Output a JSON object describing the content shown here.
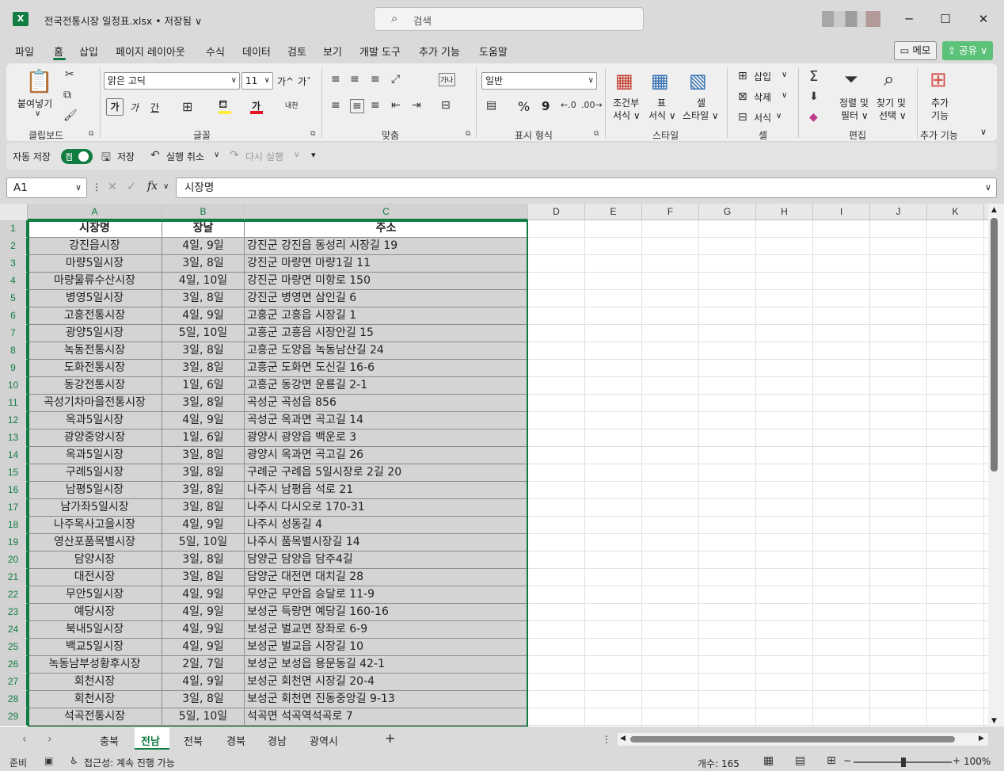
{
  "titlebar": {
    "app_icon": "X",
    "doc_title": "전국전통시장 일정표.xlsx • 저장됨 ∨",
    "search_placeholder": "검색",
    "minimize": "─",
    "maximize": "☐",
    "close": "✕"
  },
  "menu": {
    "items": [
      "파일",
      "홈",
      "삽입",
      "페이지 레이아웃",
      "수식",
      "데이터",
      "검토",
      "보기",
      "개발 도구",
      "추가 기능",
      "도움말"
    ],
    "active": "홈",
    "memo": "▭ 메모",
    "share": "⇪ 공유 ∨"
  },
  "ribbon": {
    "clipboard": {
      "paste": "붙여넣기",
      "label": "클립보드"
    },
    "font": {
      "name": "맑은 고딕",
      "size": "11",
      "grow": "가^",
      "shrink": "가ˇ",
      "bold": "가",
      "italic": "가",
      "underline": "간",
      "fontcolor": "가",
      "phonetic": "내천",
      "label": "글꼴"
    },
    "alignment": {
      "label": "맞춤",
      "wrap": "가나"
    },
    "number": {
      "format": "일반",
      "label": "표시 형식",
      "percent": "%",
      "comma": "9"
    },
    "styles": {
      "conditional_1": "조건부",
      "conditional_2": "서식 ∨",
      "table_1": "표",
      "table_2": "서식 ∨",
      "cell_1": "셀",
      "cell_2": "스타일 ∨",
      "label": "스타일"
    },
    "cells": {
      "insert": "삽입",
      "delete": "삭제",
      "format": "서식",
      "label": "셀"
    },
    "editing": {
      "sort_1": "정렬 및",
      "sort_2": "필터 ∨",
      "find_1": "찾기 및",
      "find_2": "선택 ∨",
      "label": "편집"
    },
    "addins": {
      "btn_1": "추가",
      "btn_2": "기능",
      "label": "추가 기능"
    }
  },
  "qat": {
    "autosave_label": "자동 저장",
    "autosave_state": "켬",
    "save": "저장",
    "undo": "실행 취소",
    "redo": "다시 실행"
  },
  "formula_bar": {
    "namebox": "A1",
    "fx": "fx",
    "content": "시장명"
  },
  "columns": [
    "A",
    "B",
    "C",
    "D",
    "E",
    "F",
    "G",
    "H",
    "I",
    "J",
    "K"
  ],
  "table": {
    "headers": [
      "시장명",
      "장날",
      "주소"
    ],
    "rows": [
      [
        "강진읍시장",
        "4일, 9일",
        "강진군 강진읍 동성리 시장길 19"
      ],
      [
        "마량5일시장",
        "3일, 8일",
        "강진군 마량면 마량1길 11"
      ],
      [
        "마량물류수산시장",
        "4일, 10일",
        "강진군 마량면 미항로 150"
      ],
      [
        "병영5일시장",
        "3일, 8일",
        "강진군 병영면 삼인길 6"
      ],
      [
        "고흥전통시장",
        "4일, 9일",
        "고흥군 고흥읍 시장길 1"
      ],
      [
        "광양5일시장",
        "5일, 10일",
        "고흥군 고흥읍 시장안길 15"
      ],
      [
        "녹동전통시장",
        "3일, 8일",
        "고흥군 도양읍 녹동남산길 24"
      ],
      [
        "도화전통시장",
        "3일, 8일",
        "고흥군 도화면 도신길 16-6"
      ],
      [
        "동강전통시장",
        "1일, 6일",
        "고흥군 동강면 운룡길 2-1"
      ],
      [
        "곡성기차마을전통시장",
        "3일, 8일",
        "곡성군 곡성읍 856"
      ],
      [
        "옥과5일시장",
        "4일, 9일",
        "곡성군 옥과면 곡고길 14"
      ],
      [
        "광양중앙시장",
        "1일, 6일",
        "광양시 광양읍 백운로 3"
      ],
      [
        "옥과5일시장",
        "3일, 8일",
        "광양시 옥과면 곡고길 26"
      ],
      [
        "구례5일시장",
        "3일, 8일",
        "구례군 구례읍 5일시장로 2길 20"
      ],
      [
        "남평5일시장",
        "3일, 8일",
        "나주시 남평읍 석로 21"
      ],
      [
        "남가좌5일시장",
        "3일, 8일",
        "나주시 다시오로 170-31"
      ],
      [
        "나주목사고을시장",
        "4일, 9일",
        "나주시 성동길 4"
      ],
      [
        "영산포품목별시장",
        "5일, 10일",
        "나주시 품목별시장길 14"
      ],
      [
        "담양시장",
        "3일, 8일",
        "담양군 담양읍 담주4길"
      ],
      [
        "대전시장",
        "3일, 8일",
        "담양군 대전면 대치길 28"
      ],
      [
        "무안5일시장",
        "4일, 9일",
        "무안군 무안읍 승달로 11-9"
      ],
      [
        "예당시장",
        "4일, 9일",
        "보성군 득량면 예당길 160-16"
      ],
      [
        "북내5일시장",
        "4일, 9일",
        "보성군 벌교면 장좌로 6-9"
      ],
      [
        "백교5일시장",
        "4일, 9일",
        "보성군 벌교읍 시장길 10"
      ],
      [
        "녹동남부성황후시장",
        "2일, 7일",
        "보성군 보성읍 용문동길 42-1"
      ],
      [
        "회천시장",
        "4일, 9일",
        "보성군 회천면 시장길 20-4"
      ],
      [
        "회천시장",
        "3일, 8일",
        "보성군 회천면 진동중앙길 9-13"
      ],
      [
        "석곡전통시장",
        "5일, 10일",
        "석곡면 석곡역석곡로 7"
      ]
    ]
  },
  "sheets": {
    "tabs": [
      "충북",
      "전남",
      "전북",
      "경북",
      "경남",
      "광역시"
    ],
    "active": "전남",
    "add": "+"
  },
  "status": {
    "ready": "준비",
    "accessibility": "접근성: 계속 진행 가능",
    "count": "개수: 165",
    "zoom": "100%",
    "zoom_level": 1.0
  }
}
